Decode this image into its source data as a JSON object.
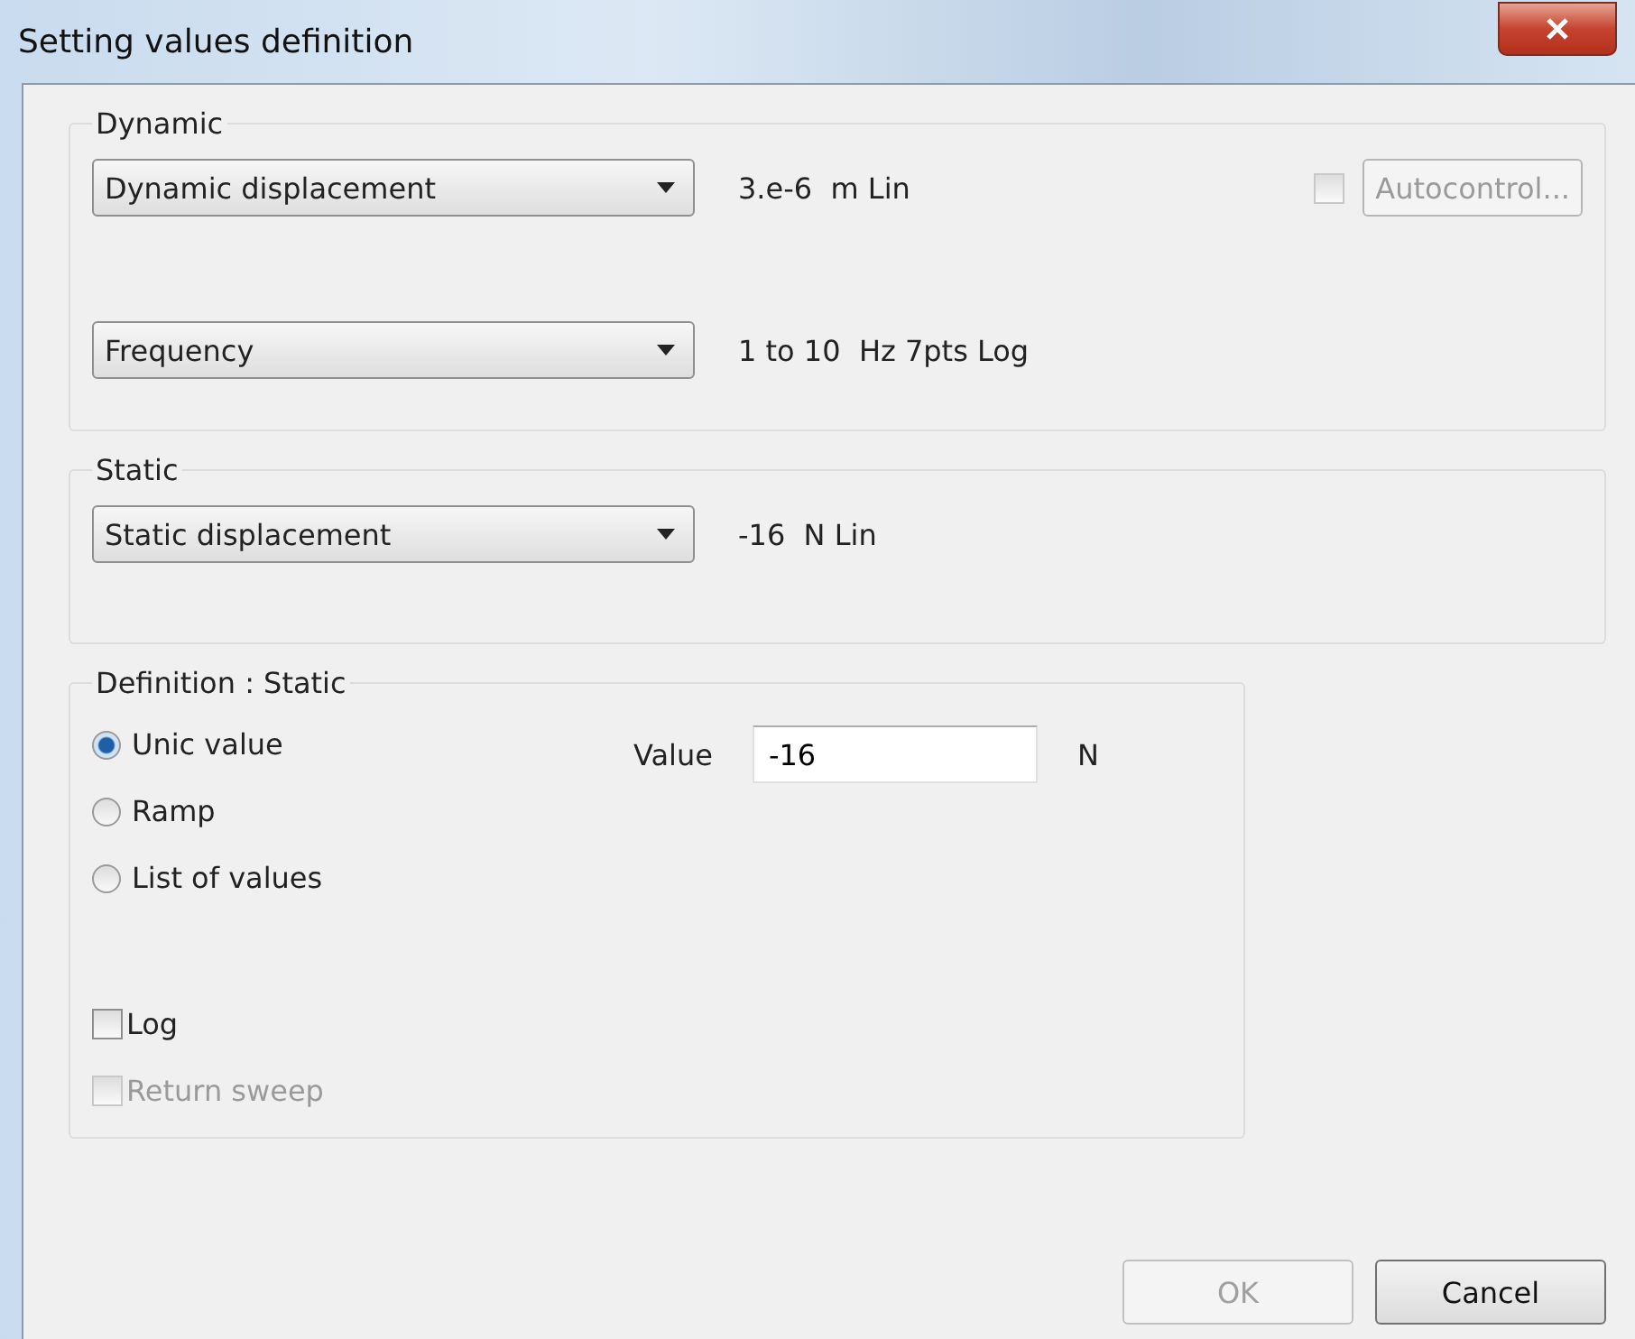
{
  "window": {
    "title": "Setting values definition"
  },
  "dynamic": {
    "label": "Dynamic",
    "selectors": [
      {
        "value": "Dynamic displacement",
        "reading": "3.e-6  m Lin"
      },
      {
        "value": "Frequency",
        "reading": "1 to 10  Hz 7pts Log"
      }
    ],
    "autocontrol": {
      "checked": false,
      "disabled": true,
      "label": "Autocontrol..."
    }
  },
  "static": {
    "label": "Static",
    "selectors": [
      {
        "value": "Static displacement",
        "reading": "-16  N Lin"
      }
    ]
  },
  "definition": {
    "label": "Definition : Static",
    "options": [
      {
        "label": "Unic value",
        "selected": true
      },
      {
        "label": "Ramp",
        "selected": false
      },
      {
        "label": "List of values",
        "selected": false
      }
    ],
    "value_label": "Value",
    "value": "-16",
    "unit": "N",
    "checks": [
      {
        "label": "Log",
        "checked": false,
        "disabled": false
      },
      {
        "label": "Return sweep",
        "checked": false,
        "disabled": true
      }
    ]
  },
  "buttons": [
    {
      "label": "OK",
      "disabled": true
    },
    {
      "label": "Cancel",
      "disabled": false
    }
  ]
}
